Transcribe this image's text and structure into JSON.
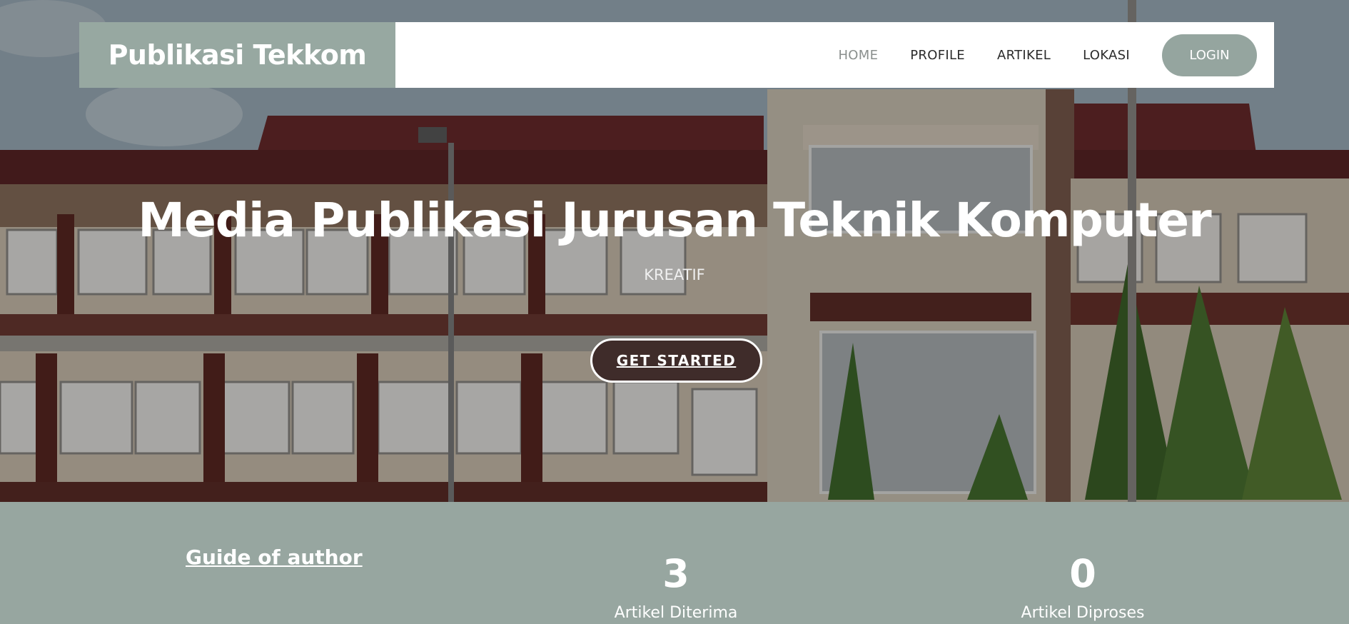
{
  "brand": {
    "name": "Publikasi Tekkom"
  },
  "nav": {
    "items": [
      {
        "label": "HOME",
        "active": true
      },
      {
        "label": "PROFILE",
        "active": false
      },
      {
        "label": "ARTIKEL",
        "active": false
      },
      {
        "label": "LOKASI",
        "active": false
      }
    ],
    "login_label": "LOGIN"
  },
  "hero": {
    "title": "Media Publikasi Jurusan Teknik Komputer",
    "subtitle": "KREATIF",
    "cta_label": "GET STARTED"
  },
  "stats": {
    "guide_label": "Guide of author",
    "items": [
      {
        "value": "3",
        "label": "Artikel Diterima"
      },
      {
        "value": "0",
        "label": "Artikel Diproses"
      }
    ]
  },
  "colors": {
    "brand_bg": "#97a8a1",
    "accent": "#95a59f",
    "cta_bg": "#3f2c2a",
    "stats_bg": "#97a6a0"
  }
}
